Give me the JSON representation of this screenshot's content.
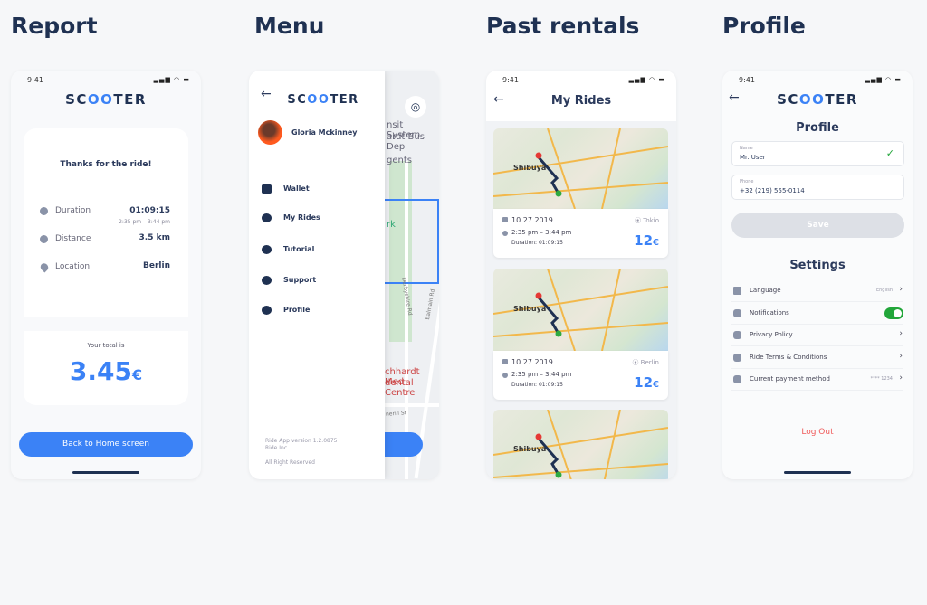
{
  "sections": [
    "Report",
    "Menu",
    "Past rentals",
    "Profile"
  ],
  "status_time": "9:41",
  "status_icons": "▂▄▆ ◠ ▬",
  "logo": {
    "pre": "SC",
    "mid": "OO",
    "post": "TER"
  },
  "report": {
    "thanks": "Thanks for the ride!",
    "duration_label": "Duration",
    "duration": "01:09:15",
    "time_range": "2:35 pm – 3:44 pm",
    "distance_label": "Distance",
    "distance": "3.5 km",
    "location_label": "Location",
    "location": "Berlin",
    "total_label": "Your total is",
    "total": "3.45",
    "currency": "€",
    "button": "Back to Home screen"
  },
  "menu": {
    "user": "Gloria Mckinney",
    "items": [
      {
        "label": "Wallet",
        "icon": "wallet-icon"
      },
      {
        "label": "My Rides",
        "icon": "clock-icon"
      },
      {
        "label": "Tutorial",
        "icon": "info-icon"
      },
      {
        "label": "Support",
        "icon": "chat-icon"
      },
      {
        "label": "Profile",
        "icon": "user-icon"
      }
    ],
    "version": "Ride App version 1.2.0875",
    "company": "Ride Inc",
    "rights": "All Right Reserved",
    "map_labels": [
      "nsit System",
      "ardt Bus Dep",
      "gents",
      "rk",
      "Derbyshire Rd",
      "Balmain Rd",
      "chhardt Med",
      "dental Centre",
      "nerill St"
    ]
  },
  "rides": {
    "title": "My Rides",
    "map_label": "Shibuya",
    "items": [
      {
        "date": "10.27.2019",
        "city": "Tokio",
        "time": "2:35 pm – 3:44 pm",
        "duration": "Duration: 01:09:15",
        "price": "12",
        "currency": "€"
      },
      {
        "date": "10.27.2019",
        "city": "Berlin",
        "time": "2:35 pm – 3:44 pm",
        "duration": "Duration: 01:09:15",
        "price": "12",
        "currency": "€"
      },
      {
        "date": "",
        "city": "",
        "time": "",
        "duration": "",
        "price": "",
        "currency": ""
      }
    ]
  },
  "profile": {
    "title": "Profile",
    "name_label": "Name",
    "name": "Mr. User",
    "phone_label": "Phone",
    "phone": "+32 (219) 555-0114",
    "save": "Save",
    "settings_title": "Settings",
    "settings": [
      {
        "label": "Language",
        "value": "English",
        "icon": "star-icon"
      },
      {
        "label": "Notifications",
        "value": "",
        "icon": "bell-icon",
        "toggle": true
      },
      {
        "label": "Privacy Policy",
        "value": "",
        "icon": "shield-icon"
      },
      {
        "label": "Ride Terms & Conditions",
        "value": "",
        "icon": "document-icon"
      },
      {
        "label": "Current payment method",
        "value": "**** 1234",
        "icon": "wallet-icon"
      }
    ],
    "logout": "Log Out"
  },
  "colors": {
    "accent": "#3b82f6",
    "navy": "#1f3152",
    "toggle": "#22a63a",
    "logout": "#f05a5a"
  }
}
